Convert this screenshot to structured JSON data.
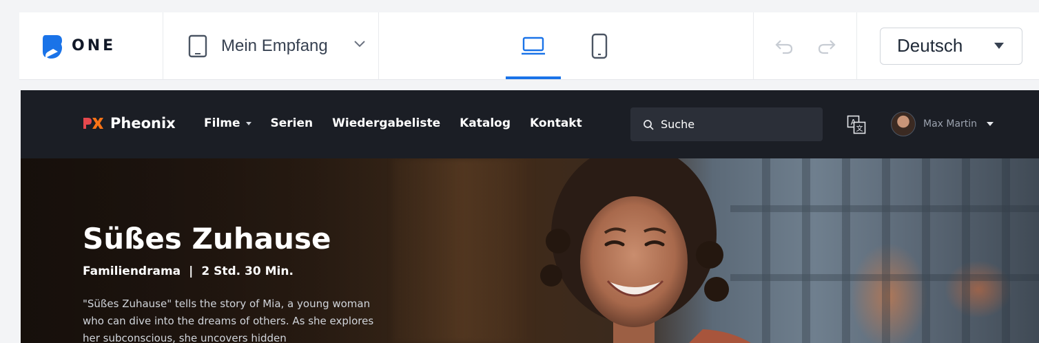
{
  "toolbar": {
    "logo_text": "ONE",
    "channel_label": "Mein Empfang",
    "language": "Deutsch"
  },
  "site": {
    "brand_mark": "PX",
    "brand_name": "Pheonix",
    "nav": [
      {
        "label": "Filme",
        "has_dropdown": true
      },
      {
        "label": "Serien"
      },
      {
        "label": "Wiedergabeliste"
      },
      {
        "label": "Katalog"
      },
      {
        "label": "Kontakt"
      }
    ],
    "search_placeholder": "Suche",
    "user_name": "Max Martin"
  },
  "hero": {
    "title": "Süßes Zuhause",
    "genre": "Familiendrama",
    "separator": "|",
    "duration": "2 Std. 30 Min.",
    "description": "\"Süßes Zuhause\" tells the story of Mia, a young woman who can dive into the dreams of others. As she explores her subconscious, she uncovers hidden"
  },
  "colors": {
    "accent": "#1a73e8",
    "brand_orange": "#f97316",
    "brand_red": "#e5484d",
    "nav_bg": "#1b1e25"
  },
  "icons": [
    "one-logo-icon",
    "tablet-icon",
    "chevron-down-icon",
    "laptop-icon",
    "phone-icon",
    "undo-icon",
    "redo-icon",
    "caret-down-icon",
    "search-icon",
    "translate-icon",
    "avatar"
  ]
}
